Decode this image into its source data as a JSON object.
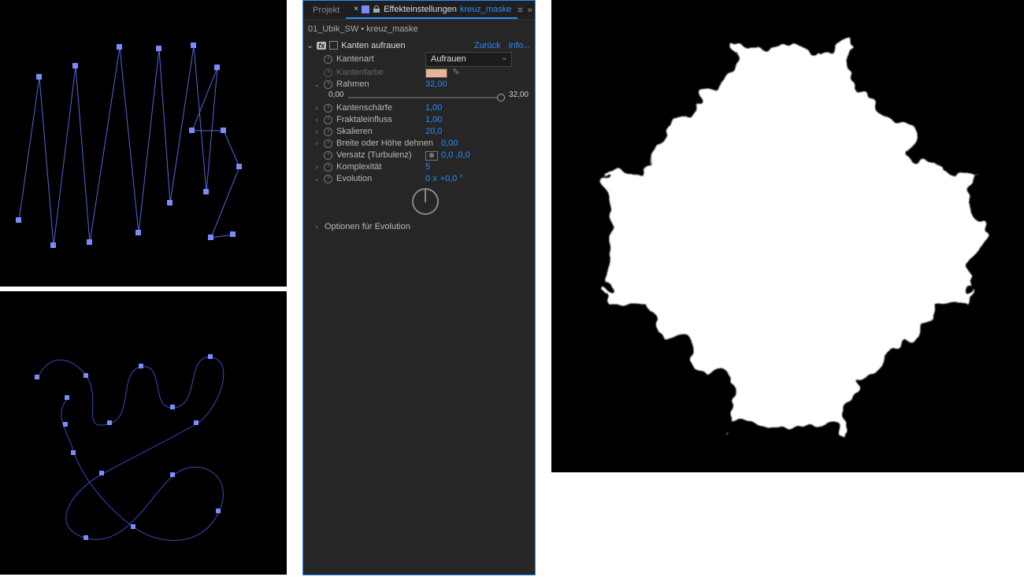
{
  "tabs": {
    "project": "Projekt",
    "effects_label": "Effekteinstellungen",
    "effects_layer": "kreuz_maske"
  },
  "comp_path": "01_Ubik_SW • kreuz_maske",
  "effect": {
    "name": "Kanten aufrauen",
    "reset": "Zurück",
    "about": "Info..."
  },
  "params": {
    "edge_type": {
      "label": "Kantenart",
      "value": "Aufrauen"
    },
    "edge_color": {
      "label": "Kantenfarbe",
      "swatch": "#e6b59a"
    },
    "border": {
      "label": "Rahmen",
      "value": "32,00",
      "slider_min": "0,00",
      "slider_max": "32,00"
    },
    "edge_sharp": {
      "label": "Kantenschärfe",
      "value": "1,00"
    },
    "fractal": {
      "label": "Fraktaleinfluss",
      "value": "1,00"
    },
    "scale": {
      "label": "Skalieren",
      "value": "20,0"
    },
    "stretch": {
      "label": "Breite oder Höhe dehnen",
      "value": "0,00"
    },
    "offset": {
      "label": "Versatz (Turbulenz)",
      "value": "0,0 ,0,0"
    },
    "complexity": {
      "label": "Komplexität",
      "value": "5"
    },
    "evolution": {
      "label": "Evolution",
      "value_a": "0 x",
      "value_b": "+0,0 °"
    },
    "evo_options": {
      "label": "Optionen für Evolution"
    }
  },
  "colors": {
    "link": "#2a8cff",
    "path": "#5566dd",
    "anchor_fill": "#7b8bff"
  }
}
